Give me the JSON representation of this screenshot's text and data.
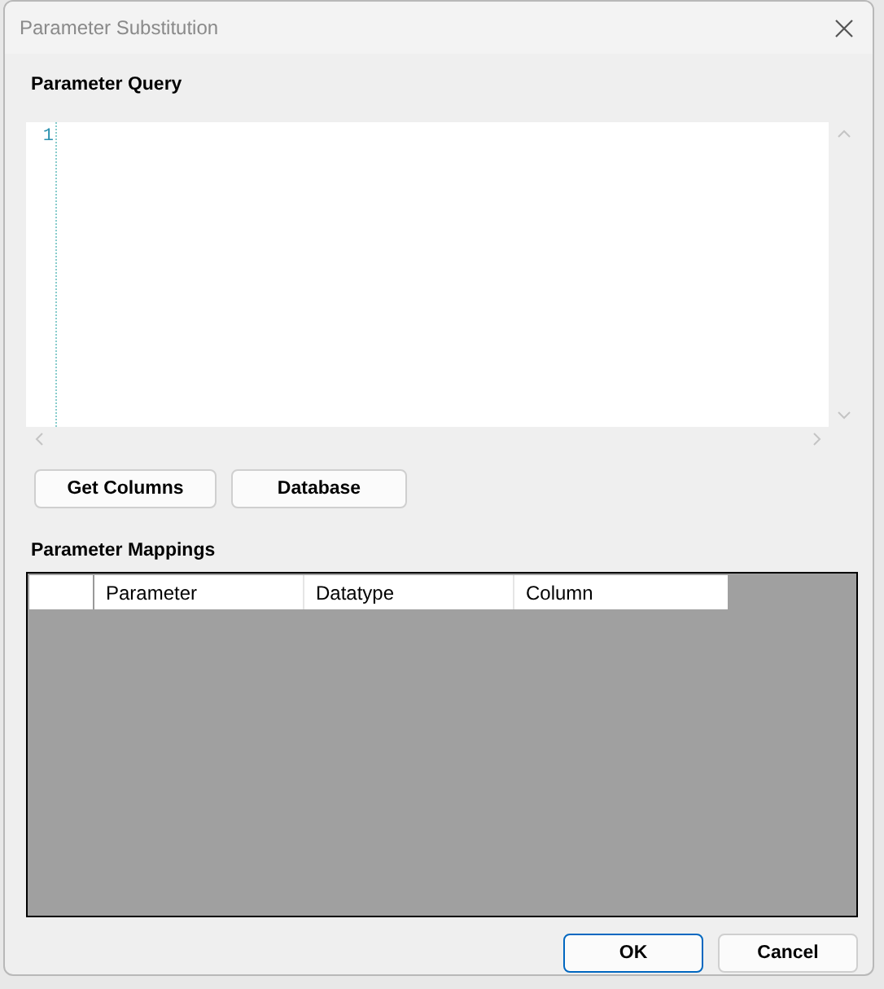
{
  "window": {
    "title": "Parameter Substitution"
  },
  "query": {
    "label": "Parameter Query",
    "line_numbers": [
      "1"
    ]
  },
  "query_buttons": [
    {
      "label": "Get Columns"
    },
    {
      "label": "Database"
    }
  ],
  "mappings": {
    "label": "Parameter Mappings",
    "columns": [
      "Parameter",
      "Datatype",
      "Column"
    ]
  },
  "dialog_buttons": [
    {
      "label": "OK",
      "default": true
    },
    {
      "label": "Cancel",
      "default": false
    }
  ]
}
